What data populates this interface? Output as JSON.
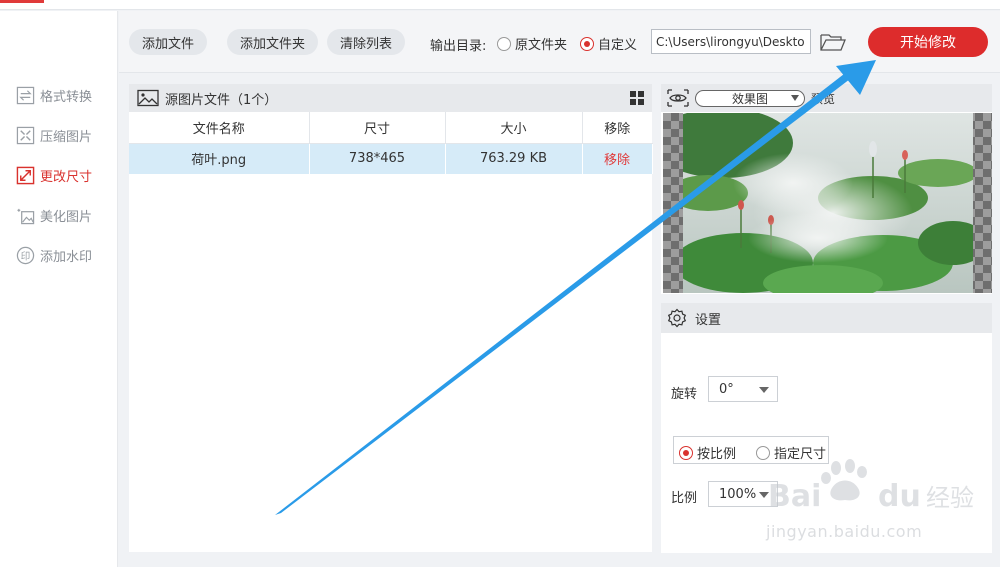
{
  "sidebar": {
    "items": [
      {
        "label": "格式转换",
        "icon": "convert-icon"
      },
      {
        "label": "压缩图片",
        "icon": "compress-icon"
      },
      {
        "label": "更改尺寸",
        "icon": "resize-icon",
        "active": true
      },
      {
        "label": "美化图片",
        "icon": "beautify-icon"
      },
      {
        "label": "添加水印",
        "icon": "watermark-stamp-icon"
      }
    ]
  },
  "toolbar": {
    "add_file": "添加文件",
    "add_folder": "添加文件夹",
    "clear_list": "清除列表",
    "output_label": "输出目录:",
    "radio_original": "原文件夹",
    "radio_custom": "自定义",
    "selected_output": "自定义",
    "path_value": "C:\\Users\\lirongyu\\Deskto",
    "start_button": "开始修改"
  },
  "files": {
    "header": "源图片文件（1个）",
    "columns": [
      "文件名称",
      "尺寸",
      "大小",
      "移除"
    ],
    "rows": [
      {
        "name": "荷叶.png",
        "size": "738*465",
        "bytes": "763.29 KB",
        "remove": "移除"
      }
    ]
  },
  "preview": {
    "mode": "效果图",
    "extra": "预览"
  },
  "settings": {
    "title": "设置",
    "rotate_label": "旋转",
    "rotate_value": "0°",
    "by_ratio": "按比例",
    "by_size": "指定尺寸",
    "selected_mode": "按比例",
    "ratio_label": "比例",
    "ratio_value": "100%"
  },
  "watermark": {
    "brand": "Baidu经验",
    "url": "jingyan.baidu.com"
  },
  "colors": {
    "accent": "#dd2c2c",
    "selected_row": "#d6ebf8",
    "annotation_arrow": "#2a9be8"
  }
}
